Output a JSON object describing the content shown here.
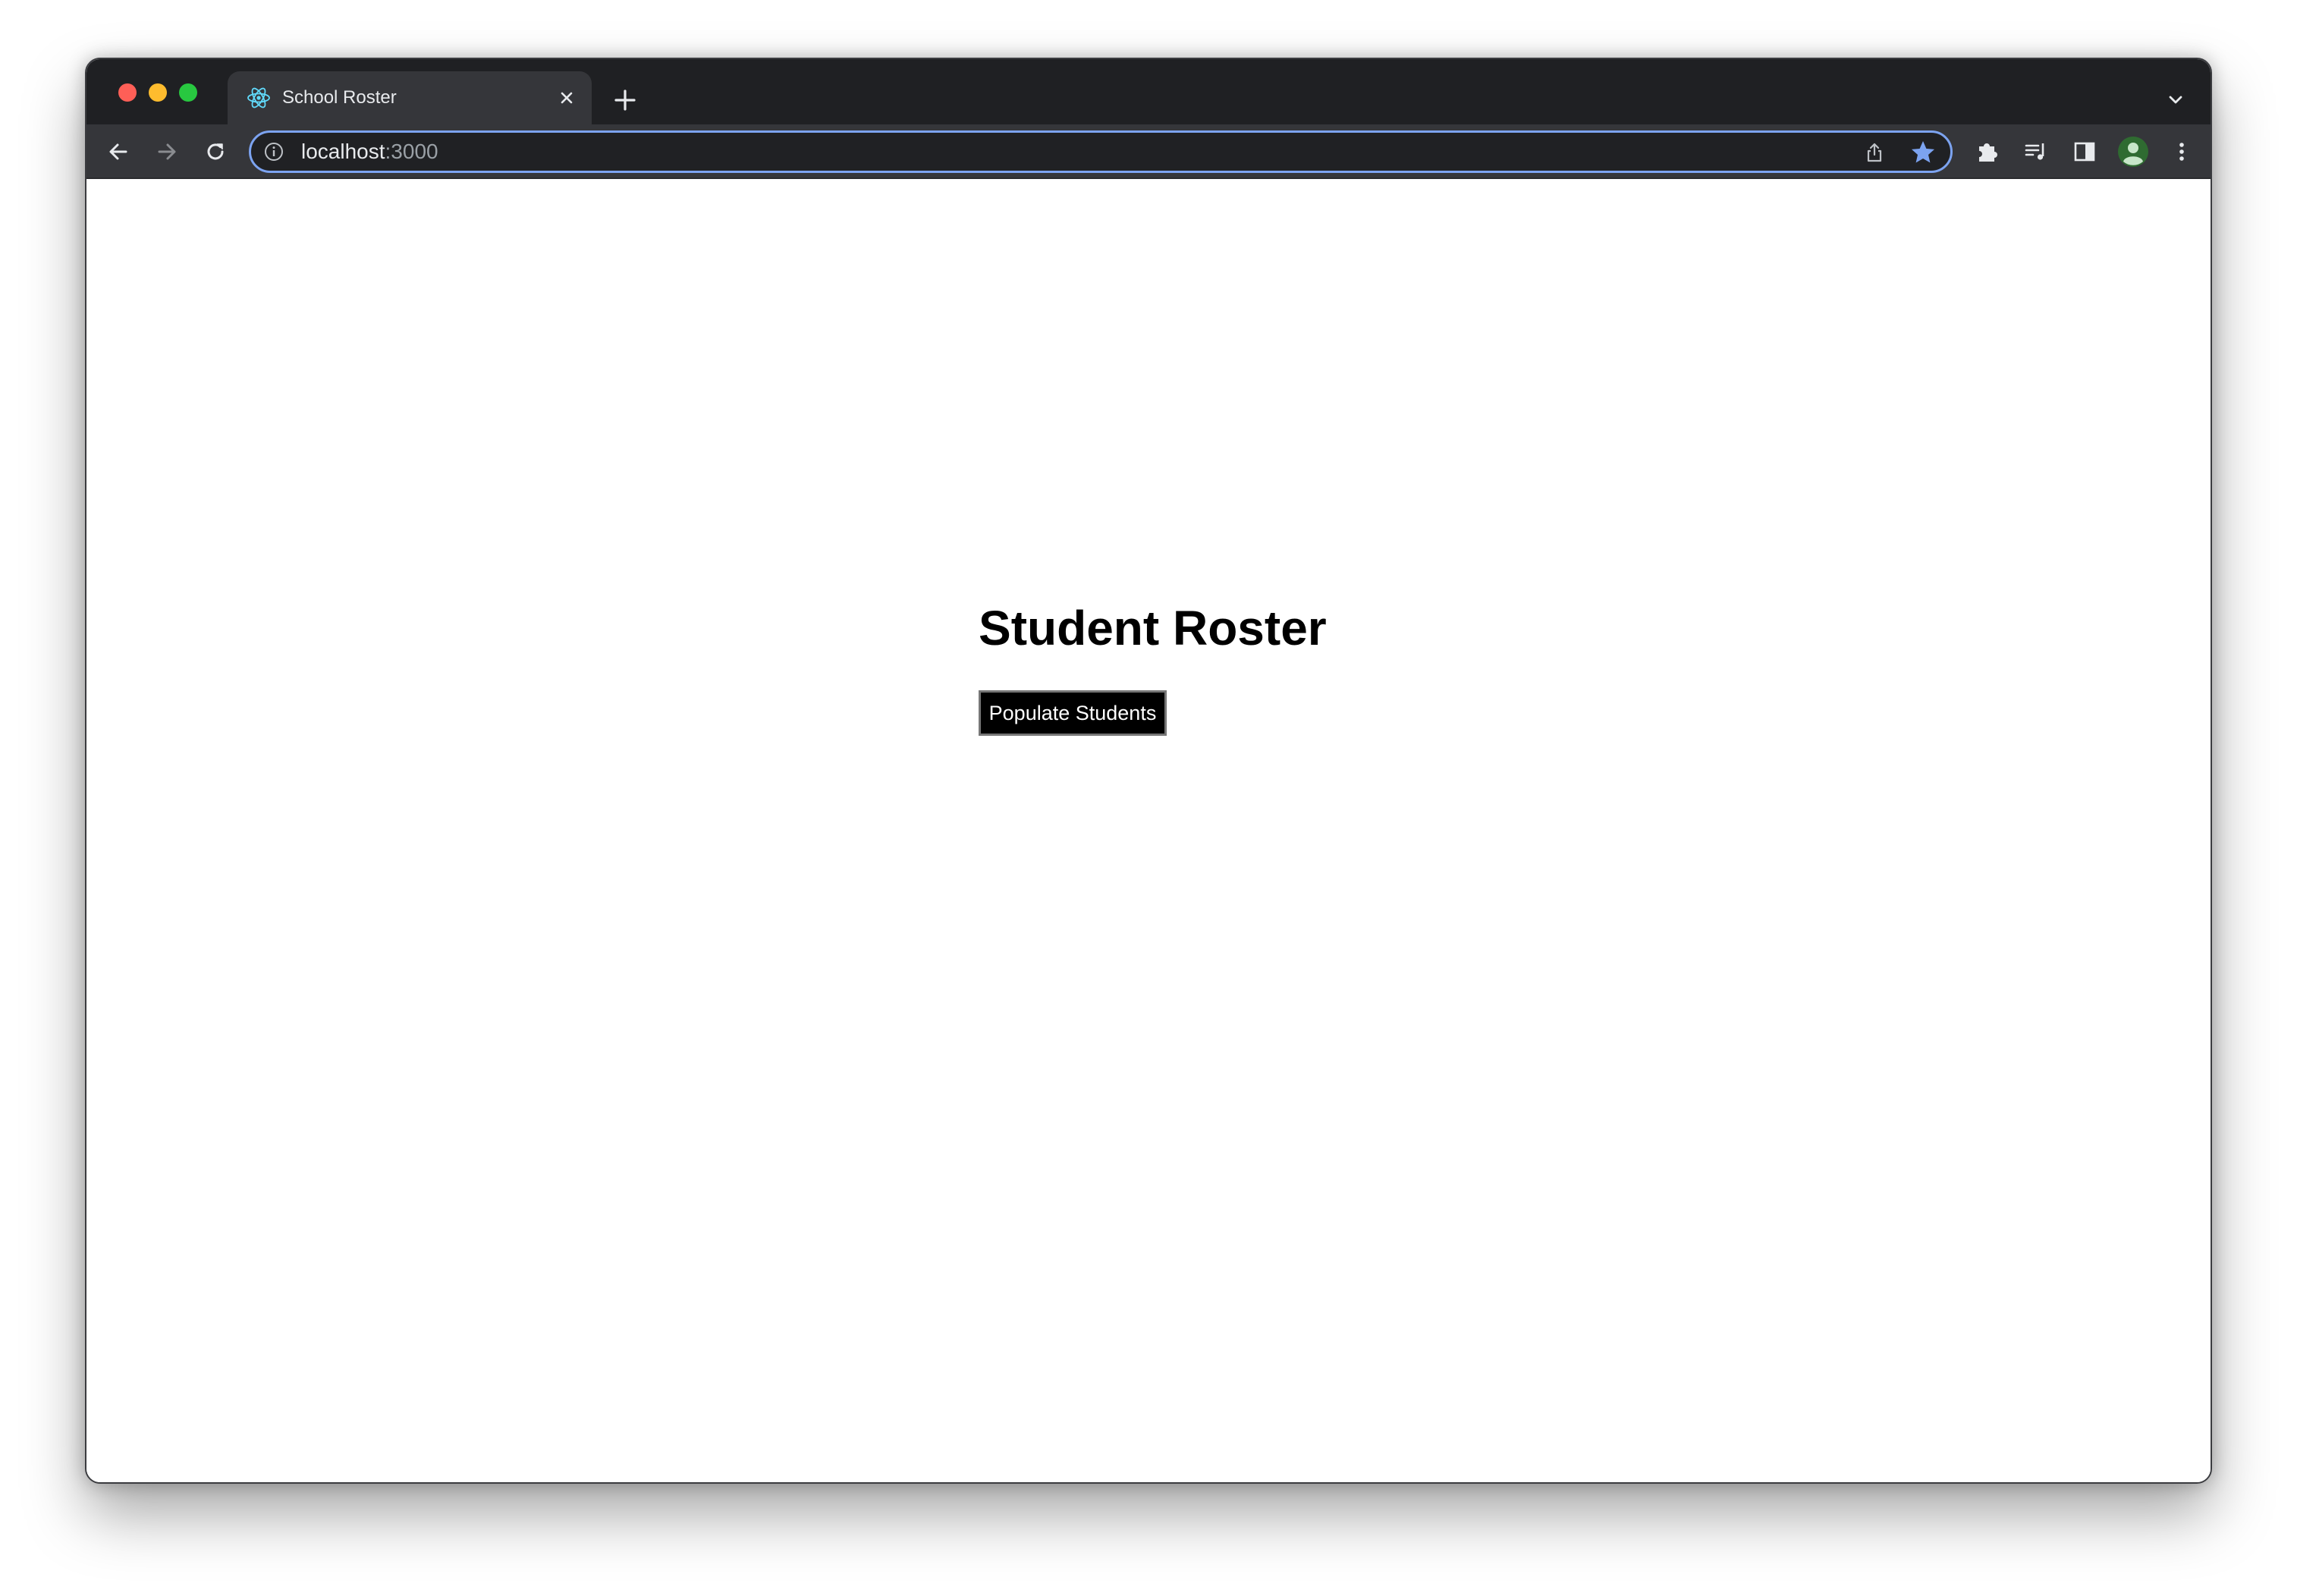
{
  "browser": {
    "tab": {
      "title": "School Roster",
      "favicon": "react-logo-icon"
    },
    "address_bar": {
      "host": "localhost",
      "port": ":3000"
    },
    "accent_color": "#7ca3f0",
    "bookmark_star_color": "#7ca3f0"
  },
  "page": {
    "heading": "Student Roster",
    "populate_button_label": "Populate Students"
  }
}
